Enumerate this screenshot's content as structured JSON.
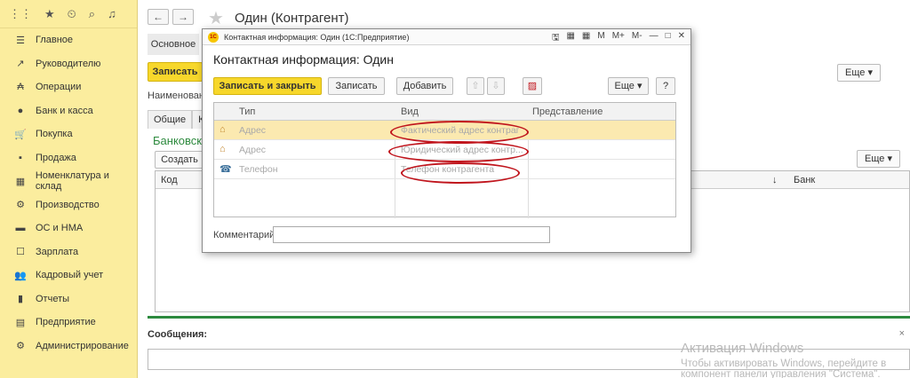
{
  "sidebar": {
    "top_icons": [
      "grid-icon",
      "star-icon",
      "history-icon",
      "search-icon",
      "bell-icon"
    ],
    "items": [
      {
        "icon": "☰",
        "label": "Главное"
      },
      {
        "icon": "↗",
        "label": "Руководителю"
      },
      {
        "icon": "₳",
        "label": "Операции"
      },
      {
        "icon": "●",
        "label": "Банк и касса"
      },
      {
        "icon": "🛒",
        "label": "Покупка"
      },
      {
        "icon": "▪",
        "label": "Продажа"
      },
      {
        "icon": "▦",
        "label": "Номенклатура и склад"
      },
      {
        "icon": "⚙",
        "label": "Производство"
      },
      {
        "icon": "▬",
        "label": "ОС и НМА"
      },
      {
        "icon": "☐",
        "label": "Зарплата"
      },
      {
        "icon": "👥",
        "label": "Кадровый учет"
      },
      {
        "icon": "▮",
        "label": "Отчеты"
      },
      {
        "icon": "▤",
        "label": "Предприятие"
      },
      {
        "icon": "⚙",
        "label": "Администрирование"
      }
    ]
  },
  "main": {
    "title": "Один (Контрагент)",
    "tab_main": "Основное",
    "save_label": "Записать",
    "naimen_label": "Наименовани",
    "tabs": [
      "Общие",
      "К"
    ],
    "bank_title": "Банковск",
    "create_label": "Создать",
    "grid_cols": {
      "kod": "Код",
      "sort": "↓",
      "bank": "Банк"
    },
    "eshe1": "Еще ▾",
    "eshe2": "Еще ▾"
  },
  "messages": {
    "label": "Сообщения:",
    "close": "×"
  },
  "activation": {
    "title": "Активация Windows",
    "line1": "Чтобы активировать Windows, перейдите в",
    "line2": "компонент панели управления \"Система\"."
  },
  "modal": {
    "window_title": "Контактная информация: Один  (1С:Предприятие)",
    "titlebar_icons": [
      "🖫",
      "▦",
      "▦",
      "M",
      "M+",
      "M-",
      "—",
      "□",
      "✕"
    ],
    "title": "Контактная информация: Один",
    "btn_save_close": "Записать и закрыть",
    "btn_save": "Записать",
    "btn_add": "Добавить",
    "btn_up": "⇧",
    "btn_down": "⇩",
    "btn_clear": "▨",
    "btn_eshe": "Еще ▾",
    "btn_help": "?",
    "columns": {
      "type": "Тип",
      "kind": "Вид",
      "repr": "Представление"
    },
    "rows": [
      {
        "icon": "⌂",
        "type": "Адрес",
        "kind": "Фактический адрес контраг"
      },
      {
        "icon": "⌂",
        "type": "Адрес",
        "kind": "Юридический адрес контр..."
      },
      {
        "icon": "☎",
        "type": "Телефон",
        "kind": "Телефон контрагента"
      }
    ],
    "comment_label": "Комментарий:",
    "comment_value": ""
  }
}
